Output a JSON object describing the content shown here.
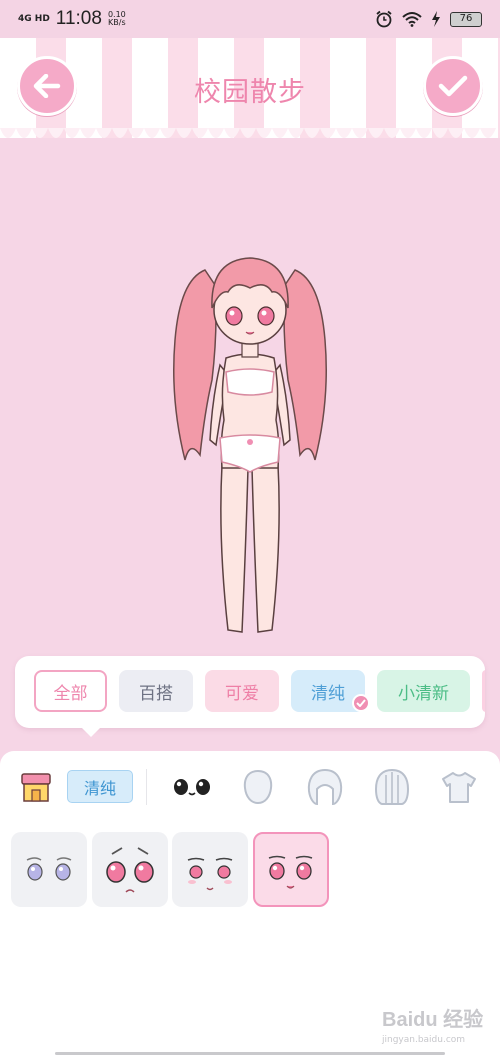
{
  "status_bar": {
    "network": "4G HD",
    "time": "11:08",
    "speed_value": "0.10",
    "speed_unit": "KB/s",
    "battery": "76",
    "icons": [
      "alarm-icon",
      "wifi-icon",
      "charging-icon",
      "battery-icon"
    ]
  },
  "header": {
    "title": "校园散步",
    "back_icon": "arrow-left-icon",
    "confirm_icon": "checkmark-icon"
  },
  "filters": {
    "items": [
      {
        "label": "全部"
      },
      {
        "label": "百搭"
      },
      {
        "label": "可爱"
      },
      {
        "label": "清纯"
      },
      {
        "label": "小清新"
      }
    ],
    "selected": "清纯"
  },
  "panel": {
    "active_tag": "清纯",
    "category_icons": [
      "shop-icon",
      "eyes-icon",
      "face-icon",
      "hair-short-icon",
      "hair-long-icon",
      "shirt-icon"
    ],
    "face_options_count": 4
  },
  "watermark": {
    "name": "Baidu 经验",
    "url": "jingyan.baidu.com"
  },
  "colors": {
    "background": "#f6d6e6",
    "accent_pink": "#ee86ad",
    "pure_blue": "#4f9fd6",
    "fresh_green": "#4cbd86"
  }
}
